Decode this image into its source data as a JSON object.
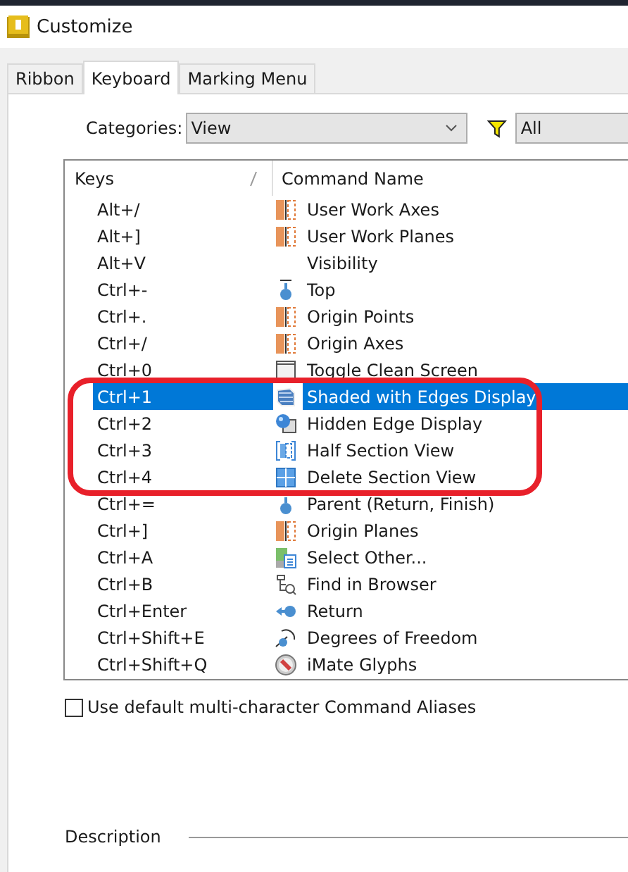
{
  "window": {
    "title": "Customize"
  },
  "tabs": [
    {
      "label": "Ribbon",
      "selected": false
    },
    {
      "label": "Keyboard",
      "selected": true
    },
    {
      "label": "Marking Menu",
      "selected": false
    }
  ],
  "filters": {
    "categories_label": "Categories:",
    "categories_value": "View",
    "filter_value": "All"
  },
  "table": {
    "columns": [
      "Keys",
      "Command Name"
    ],
    "rows": [
      {
        "keys": "Alt+/",
        "kind": "plane",
        "command": "User Work Axes",
        "selected": false,
        "circled": false
      },
      {
        "keys": "Alt+]",
        "kind": "plane",
        "command": "User Work Planes",
        "selected": false,
        "circled": false
      },
      {
        "keys": "Alt+V",
        "kind": "none",
        "command": "Visibility",
        "selected": false,
        "circled": false
      },
      {
        "keys": "Ctrl+-",
        "kind": "top",
        "command": "Top",
        "selected": false,
        "circled": false
      },
      {
        "keys": "Ctrl+.",
        "kind": "plane",
        "command": "Origin Points",
        "selected": false,
        "circled": false
      },
      {
        "keys": "Ctrl+/",
        "kind": "plane",
        "command": "Origin Axes",
        "selected": false,
        "circled": false
      },
      {
        "keys": "Ctrl+0",
        "kind": "window",
        "command": "Toggle Clean Screen",
        "selected": false,
        "circled": false
      },
      {
        "keys": "Ctrl+1",
        "kind": "shaded",
        "command": "Shaded with Edges Display",
        "selected": true,
        "circled": true
      },
      {
        "keys": "Ctrl+2",
        "kind": "hidden",
        "command": "Hidden Edge Display",
        "selected": false,
        "circled": true
      },
      {
        "keys": "Ctrl+3",
        "kind": "half",
        "command": "Half Section View",
        "selected": false,
        "circled": true
      },
      {
        "keys": "Ctrl+4",
        "kind": "grid",
        "command": "Delete Section View",
        "selected": false,
        "circled": true
      },
      {
        "keys": "Ctrl+=",
        "kind": "parent",
        "command": "Parent (Return, Finish)",
        "selected": false,
        "circled": false
      },
      {
        "keys": "Ctrl+]",
        "kind": "plane",
        "command": "Origin Planes",
        "selected": false,
        "circled": false
      },
      {
        "keys": "Ctrl+A",
        "kind": "select",
        "command": "Select Other...",
        "selected": false,
        "circled": false
      },
      {
        "keys": "Ctrl+B",
        "kind": "find",
        "command": "Find in Browser",
        "selected": false,
        "circled": false
      },
      {
        "keys": "Ctrl+Enter",
        "kind": "return",
        "command": "Return",
        "selected": false,
        "circled": false
      },
      {
        "keys": "Ctrl+Shift+E",
        "kind": "dof",
        "command": "Degrees of Freedom",
        "selected": false,
        "circled": false
      },
      {
        "keys": "Ctrl+Shift+Q",
        "kind": "imate",
        "command": "iMate Glyphs",
        "selected": false,
        "circled": false
      }
    ]
  },
  "aliases": {
    "label": "Use default multi-character Command Aliases",
    "checked": false
  },
  "description": {
    "label": "Description"
  }
}
